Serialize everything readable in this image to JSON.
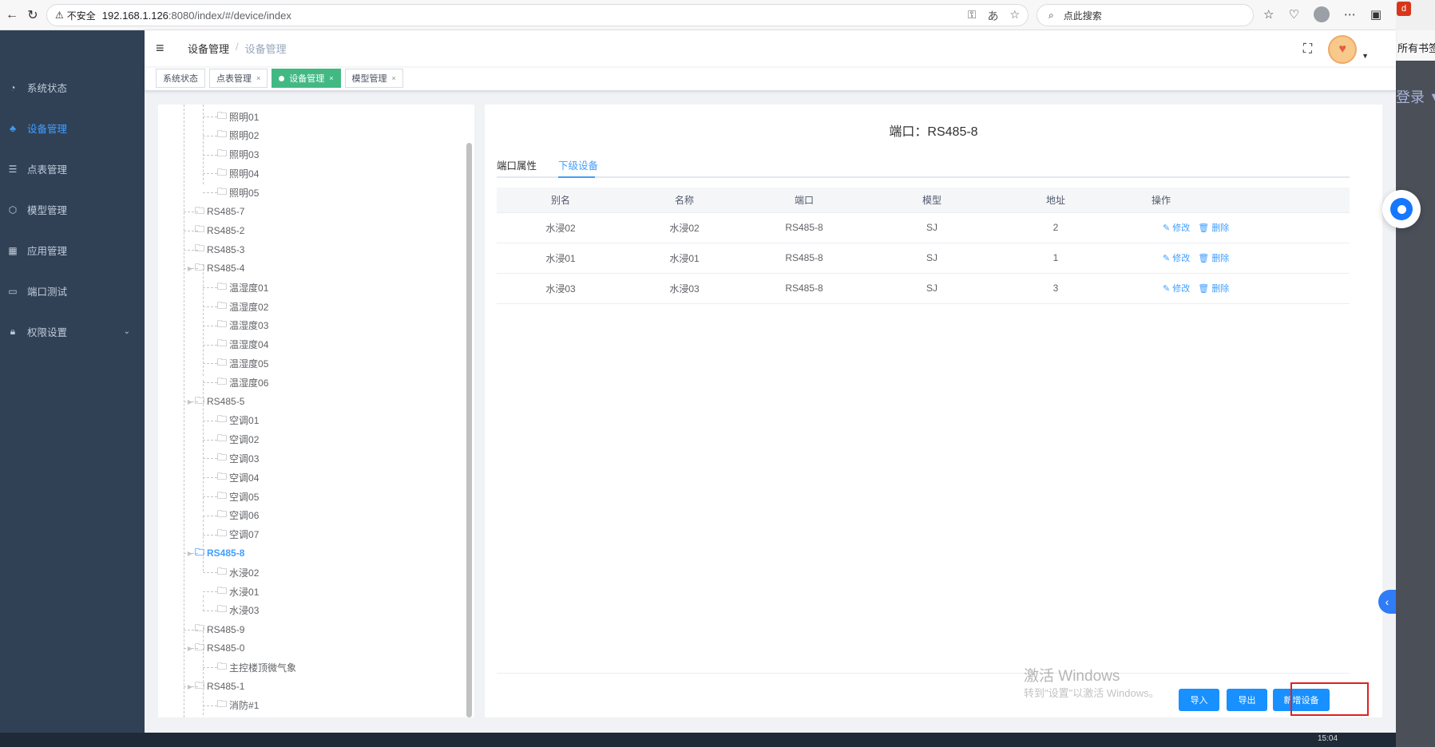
{
  "browser": {
    "security": "不安全",
    "url_host": "192.168.1.126",
    "url_rest": ":8080/index/#/device/index",
    "search_placeholder": "点此搜索"
  },
  "side_window": {
    "badge": "d",
    "bookmarks": "所有书签",
    "login": "登录 ▼"
  },
  "sidebar": {
    "items": [
      {
        "label": "系统状态",
        "icon": "dashboard-icon"
      },
      {
        "label": "设备管理",
        "icon": "sitemap-icon",
        "active": true
      },
      {
        "label": "点表管理",
        "icon": "list-icon"
      },
      {
        "label": "模型管理",
        "icon": "cube-icon"
      },
      {
        "label": "应用管理",
        "icon": "apps-icon"
      },
      {
        "label": "端口测试",
        "icon": "monitor-icon"
      },
      {
        "label": "权限设置",
        "icon": "lock-icon",
        "expandable": true
      }
    ]
  },
  "navbar": {
    "breadcrumb": [
      "设备管理",
      "设备管理"
    ]
  },
  "tags": [
    {
      "label": "系统状态",
      "closable": false,
      "active": false
    },
    {
      "label": "点表管理",
      "closable": true,
      "active": false
    },
    {
      "label": "设备管理",
      "closable": true,
      "active": true
    },
    {
      "label": "模型管理",
      "closable": true,
      "active": false
    }
  ],
  "tree": [
    {
      "label": "照明01",
      "level": 2
    },
    {
      "label": "照明02",
      "level": 2
    },
    {
      "label": "照明03",
      "level": 2
    },
    {
      "label": "照明04",
      "level": 2
    },
    {
      "label": "照明05",
      "level": 2
    },
    {
      "label": "RS485-7",
      "level": 1,
      "expandable": false
    },
    {
      "label": "RS485-2",
      "level": 1,
      "expandable": false
    },
    {
      "label": "RS485-3",
      "level": 1,
      "expandable": false
    },
    {
      "label": "RS485-4",
      "level": 1,
      "expandable": true
    },
    {
      "label": "温湿度01",
      "level": 2
    },
    {
      "label": "温湿度02",
      "level": 2
    },
    {
      "label": "温湿度03",
      "level": 2
    },
    {
      "label": "温湿度04",
      "level": 2
    },
    {
      "label": "温湿度05",
      "level": 2
    },
    {
      "label": "温湿度06",
      "level": 2
    },
    {
      "label": "RS485-5",
      "level": 1,
      "expandable": true
    },
    {
      "label": "空调01",
      "level": 2
    },
    {
      "label": "空调02",
      "level": 2
    },
    {
      "label": "空调03",
      "level": 2
    },
    {
      "label": "空调04",
      "level": 2
    },
    {
      "label": "空调05",
      "level": 2
    },
    {
      "label": "空调06",
      "level": 2
    },
    {
      "label": "空调07",
      "level": 2
    },
    {
      "label": "RS485-8",
      "level": 1,
      "expandable": true,
      "current": true
    },
    {
      "label": "水浸02",
      "level": 2
    },
    {
      "label": "水浸01",
      "level": 2
    },
    {
      "label": "水浸03",
      "level": 2
    },
    {
      "label": "RS485-9",
      "level": 1,
      "expandable": false
    },
    {
      "label": "RS485-0",
      "level": 1,
      "expandable": true
    },
    {
      "label": "主控楼顶微气象",
      "level": 2
    },
    {
      "label": "RS485-1",
      "level": 1,
      "expandable": true
    },
    {
      "label": "消防#1",
      "level": 2
    }
  ],
  "content": {
    "title": "端口：RS485-8",
    "tabs": [
      "端口属性",
      "下级设备"
    ],
    "active_tab": 1,
    "columns": [
      "别名",
      "名称",
      "端口",
      "模型",
      "地址",
      "操作"
    ],
    "rows": [
      {
        "alias": "水浸02",
        "name": "水浸02",
        "port": "RS485-8",
        "model": "SJ",
        "address": "2"
      },
      {
        "alias": "水浸01",
        "name": "水浸01",
        "port": "RS485-8",
        "model": "SJ",
        "address": "1"
      },
      {
        "alias": "水浸03",
        "name": "水浸03",
        "port": "RS485-8",
        "model": "SJ",
        "address": "3"
      }
    ],
    "edit_label": "修改",
    "delete_label": "删除",
    "buttons": {
      "import": "导入",
      "export": "导出",
      "add": "新增设备"
    }
  },
  "watermark": {
    "line1": "激活 Windows",
    "line2": "转到\"设置\"以激活 Windows。"
  },
  "taskbar": {
    "clock": "15:04"
  },
  "colors": {
    "sidebar_bg": "#304156",
    "accent": "#409eff",
    "tag_active": "#42b983",
    "button": "#1890ff",
    "highlight": "#e02020"
  }
}
